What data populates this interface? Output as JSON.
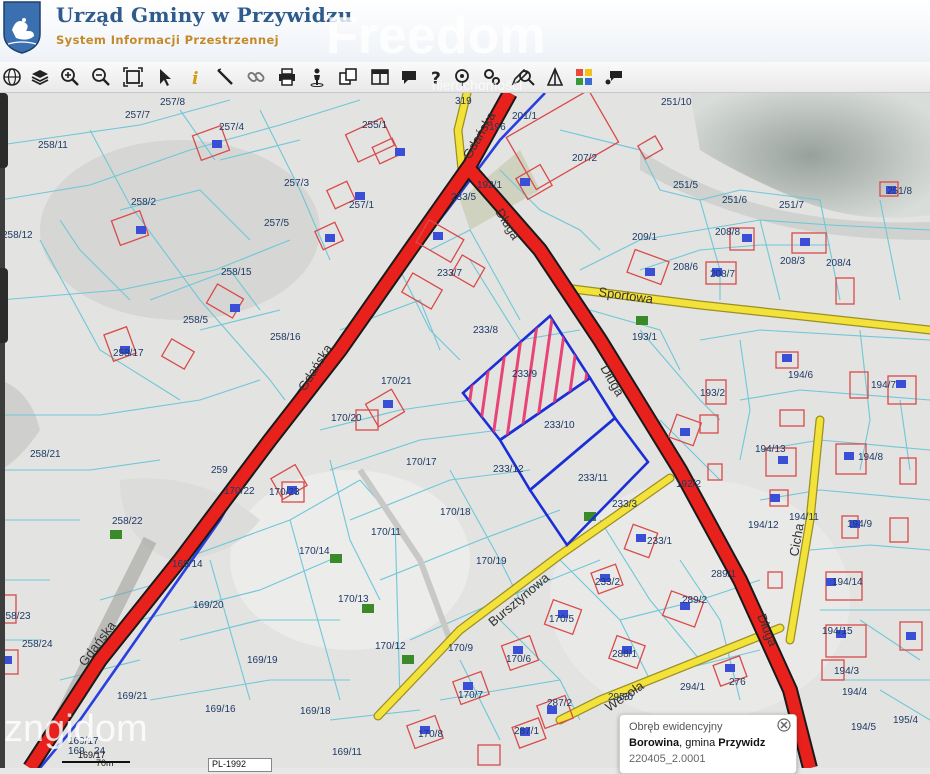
{
  "header": {
    "title": "Urząd Gminy w Przywidzu",
    "subtitle": "System Informacji Przestrzennej"
  },
  "watermarks": {
    "top": "Freedom",
    "top_sub": "nieruchomości",
    "bottom": "zngidom"
  },
  "toolbar": {
    "tools": [
      "globe-icon",
      "layers-icon",
      "zoom-in-icon",
      "zoom-out-icon",
      "zoom-extent-icon",
      "pointer-icon",
      "info-icon",
      "measure-icon",
      "link-icon",
      "print-icon",
      "person-icon",
      "copy-icon",
      "layout-icon",
      "comment-icon",
      "help-icon",
      "marker-icon",
      "settings-icon",
      "draw-icon",
      "search-icon",
      "flag-icon",
      "grid-icon",
      "chat-icon"
    ]
  },
  "map": {
    "streets": {
      "gdanska_1": "Gdańska",
      "gdanska_2": "Gdańska",
      "gdanska_3": "Gdańska",
      "dluga_1": "Długa",
      "dluga_2": "Długa",
      "dluga_3": "Długa",
      "sportowa": "Sportowa",
      "bursztynowa": "Bursztynowa",
      "wesola": "Wesoła",
      "cicha": "Cicha"
    },
    "parcel_labels": [
      "257/8",
      "257/7",
      "257/4",
      "255/1",
      "258/11",
      "257/3",
      "257/1",
      "258/2",
      "257/5",
      "258/12",
      "258/15",
      "258/5",
      "258/16",
      "258/17",
      "233/7",
      "233/8",
      "233/9",
      "233/10",
      "233/11",
      "233/12",
      "233/3",
      "233/1",
      "233/2",
      "233/5",
      "192/1",
      "319",
      "196",
      "201/1",
      "207/2",
      "251/10",
      "251/5",
      "251/6",
      "251/7",
      "251/8",
      "209/1",
      "208/8",
      "208/6",
      "208/7",
      "208/3",
      "208/4",
      "193/1",
      "193/2",
      "194/6",
      "194/7",
      "194/13",
      "194/8",
      "194/12",
      "194/11",
      "194/9",
      "194/14",
      "194/15",
      "194/3",
      "194/4",
      "194/5",
      "195/4",
      "192/2",
      "289/1",
      "289/2",
      "288/1",
      "294/1",
      "276",
      "295/0",
      "287/2",
      "287/1",
      "170/21",
      "170/20",
      "170/17",
      "170/18",
      "170/19",
      "170/22",
      "170/23",
      "170/11",
      "170/14",
      "170/13",
      "170/12",
      "170/9",
      "170/5",
      "170/6",
      "170/7",
      "170/8",
      "169/14",
      "169/20",
      "169/19",
      "169/16",
      "169/18",
      "169/21",
      "169/11",
      "258/21",
      "258/22",
      "258/23",
      "258/24",
      "259",
      "169/17",
      "169",
      "24"
    ],
    "building_marks": [
      "m",
      "g",
      "i",
      "k"
    ],
    "highlighted_parcels": [
      "233/9",
      "233/10",
      "233/11"
    ]
  },
  "popup": {
    "title": "Obręb ewidencyjny",
    "obreb": "Borowina",
    "separator": ", gmina ",
    "gmina": "Przywidz",
    "code": "220405_2.0001"
  },
  "scale": {
    "label": "70m",
    "left_label": "169/17"
  },
  "projection": "PL-1992",
  "colors": {
    "road_red": "#e8211c",
    "road_yellow": "#f2e23a",
    "parcel_line": "#6fc7d8",
    "building": "#d94a4a",
    "highlight_blue": "#1a2fd6",
    "hatch": "#e8326a",
    "title_blue": "#2e5a8c",
    "subtitle_gold": "#c48a2a"
  }
}
